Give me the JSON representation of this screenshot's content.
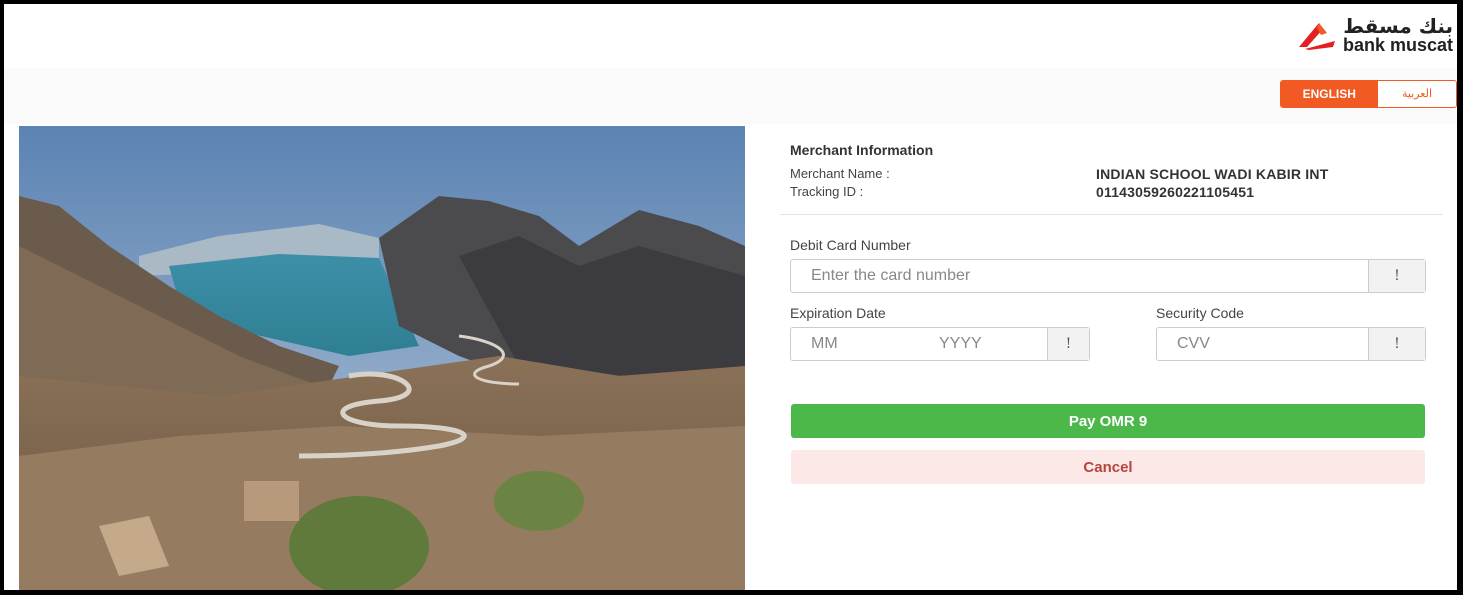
{
  "brand": {
    "logo_ar": "بنك مسقط",
    "logo_en": "bank muscat",
    "accent": "#f15a22"
  },
  "language": {
    "english_label": "ENGLISH",
    "arabic_label": "العربية",
    "selected": "ENGLISH"
  },
  "merchant": {
    "heading": "Merchant Information",
    "name_label": "Merchant Name :",
    "name_value": "INDIAN SCHOOL WADI KABIR INT",
    "tracking_label": "Tracking ID :",
    "tracking_value": "0114305926022110545​1"
  },
  "card": {
    "number_label": "Debit Card Number",
    "number_placeholder": "Enter the card number",
    "expiry_label": "Expiration Date",
    "month_placeholder": "MM",
    "year_placeholder": "YYYY",
    "security_label": "Security Code",
    "cvv_placeholder": "CVV",
    "info_glyph": "!"
  },
  "actions": {
    "pay_label": "Pay OMR 9",
    "cancel_label": "Cancel",
    "pay_color": "#4cb84a",
    "cancel_color": "#fde8e8"
  }
}
